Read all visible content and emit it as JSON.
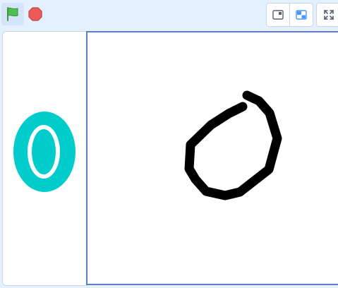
{
  "toolbar": {
    "controls": [
      {
        "name": "green-flag",
        "icon": "green-flag-icon",
        "color": "#4cbf56"
      },
      {
        "name": "stop",
        "icon": "stop-sign-icon",
        "color": "#ec5959"
      }
    ],
    "layout_modes": [
      {
        "name": "small-stage",
        "icon": "small-stage-icon",
        "selected": false
      },
      {
        "name": "normal-stage",
        "icon": "normal-stage-icon",
        "selected": true
      },
      {
        "name": "fullscreen",
        "icon": "fullscreen-icon"
      }
    ]
  },
  "sprite_thumbnail": {
    "icon": "digit-zero-costume",
    "fill_color": "#00cccc"
  },
  "stage": {
    "drawing": "pen-drawn-zero",
    "stroke_color": "#000000"
  },
  "colors": {
    "background": "#e5f0ff",
    "stage_border": "#5b80bf",
    "accent": "#4c97ff"
  }
}
